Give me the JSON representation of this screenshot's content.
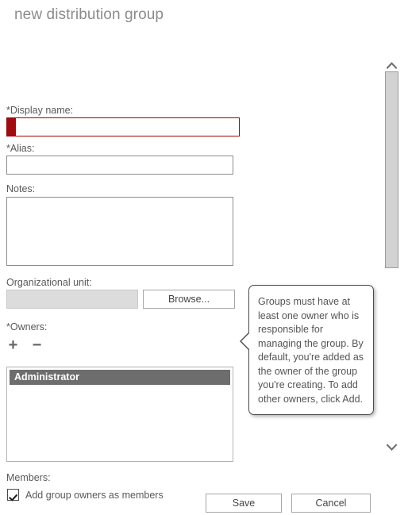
{
  "header": {
    "title": "new distribution group"
  },
  "form": {
    "display_name": {
      "label": "*Display name:",
      "value": "",
      "placeholder": "",
      "required": true,
      "invalid_color": "#a80000",
      "marker_color": "#9e0b11"
    },
    "alias": {
      "label": "*Alias:",
      "value": "",
      "placeholder": "",
      "required": true
    },
    "notes": {
      "label": "Notes:",
      "value": "",
      "placeholder": ""
    },
    "organizational_unit": {
      "label": "Organizational unit:",
      "value": "",
      "placeholder": "",
      "disabled": true,
      "browse_label": "Browse..."
    },
    "owners": {
      "label": "*Owners:",
      "add_icon": "plus-icon",
      "remove_icon": "minus-icon",
      "add_glyph": "+",
      "remove_glyph": "−",
      "items": [
        {
          "name": "Administrator",
          "selected": true
        }
      ]
    },
    "members": {
      "label": "Members:",
      "checkbox_label": "Add group owners as members",
      "checked": true
    }
  },
  "callout": {
    "text": "Groups must have at least one owner who is responsible for managing the group. By default, you're added as the owner of the group you're creating. To add other owners, click Add."
  },
  "scrollbar": {
    "up_icon": "chevron-up-icon",
    "down_icon": "chevron-down-icon"
  },
  "footer": {
    "save_label": "Save",
    "cancel_label": "Cancel"
  },
  "colors": {
    "title_gray": "#8c8c8c",
    "label_gray": "#595959",
    "border_gray": "#8c8c8c",
    "selection_gray": "#6d6d6d",
    "required_red": "#9e0b11",
    "scroll_thumb": "#d2d2d2"
  }
}
